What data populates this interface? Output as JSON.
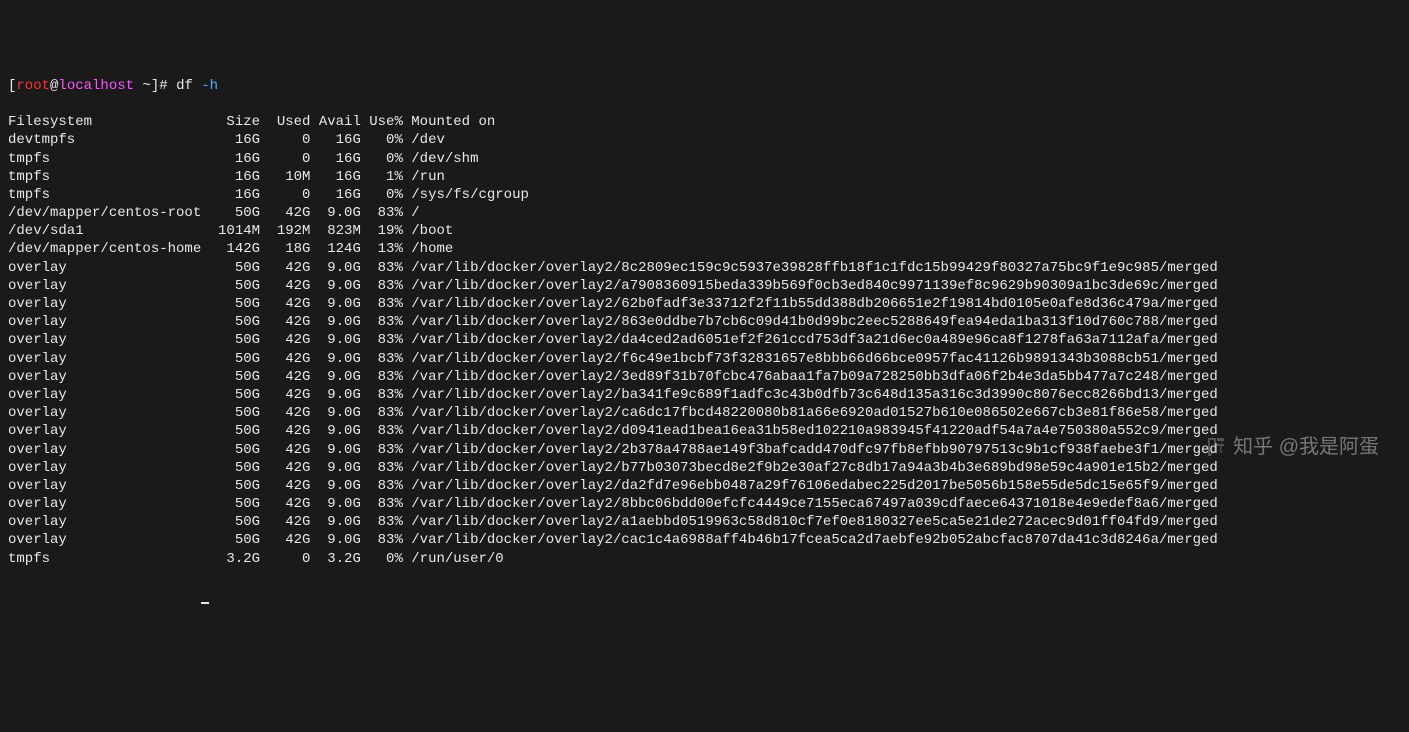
{
  "prompt": {
    "open_bracket": "[",
    "user": "root",
    "at": "@",
    "host": "localhost",
    "space": " ",
    "tilde": "~",
    "close_bracket": "]#",
    "command": " df ",
    "flag": "-h"
  },
  "header": {
    "filesystem": "Filesystem",
    "size": "Size",
    "used": "Used",
    "avail": "Avail",
    "usep": "Use%",
    "mounted": "Mounted on"
  },
  "chart_data": {
    "type": "table",
    "columns": [
      "Filesystem",
      "Size",
      "Used",
      "Avail",
      "Use%",
      "Mounted on"
    ],
    "rows": [
      [
        "devtmpfs",
        "16G",
        "0",
        "16G",
        "0%",
        "/dev"
      ],
      [
        "tmpfs",
        "16G",
        "0",
        "16G",
        "0%",
        "/dev/shm"
      ],
      [
        "tmpfs",
        "16G",
        "10M",
        "16G",
        "1%",
        "/run"
      ],
      [
        "tmpfs",
        "16G",
        "0",
        "16G",
        "0%",
        "/sys/fs/cgroup"
      ],
      [
        "/dev/mapper/centos-root",
        "50G",
        "42G",
        "9.0G",
        "83%",
        "/"
      ],
      [
        "/dev/sda1",
        "1014M",
        "192M",
        "823M",
        "19%",
        "/boot"
      ],
      [
        "/dev/mapper/centos-home",
        "142G",
        "18G",
        "124G",
        "13%",
        "/home"
      ],
      [
        "overlay",
        "50G",
        "42G",
        "9.0G",
        "83%",
        "/var/lib/docker/overlay2/8c2809ec159c9c5937e39828ffb18f1c1fdc15b99429f80327a75bc9f1e9c985/merged"
      ],
      [
        "overlay",
        "50G",
        "42G",
        "9.0G",
        "83%",
        "/var/lib/docker/overlay2/a7908360915beda339b569f0cb3ed840c9971139ef8c9629b90309a1bc3de69c/merged"
      ],
      [
        "overlay",
        "50G",
        "42G",
        "9.0G",
        "83%",
        "/var/lib/docker/overlay2/62b0fadf3e33712f2f11b55dd388db206651e2f19814bd0105e0afe8d36c479a/merged"
      ],
      [
        "overlay",
        "50G",
        "42G",
        "9.0G",
        "83%",
        "/var/lib/docker/overlay2/863e0ddbe7b7cb6c09d41b0d99bc2eec5288649fea94eda1ba313f10d760c788/merged"
      ],
      [
        "overlay",
        "50G",
        "42G",
        "9.0G",
        "83%",
        "/var/lib/docker/overlay2/da4ced2ad6051ef2f261ccd753df3a21d6ec0a489e96ca8f1278fa63a7112afa/merged"
      ],
      [
        "overlay",
        "50G",
        "42G",
        "9.0G",
        "83%",
        "/var/lib/docker/overlay2/f6c49e1bcbf73f32831657e8bbb66d66bce0957fac41126b9891343b3088cb51/merged"
      ],
      [
        "overlay",
        "50G",
        "42G",
        "9.0G",
        "83%",
        "/var/lib/docker/overlay2/3ed89f31b70fcbc476abaa1fa7b09a728250bb3dfa06f2b4e3da5bb477a7c248/merged"
      ],
      [
        "overlay",
        "50G",
        "42G",
        "9.0G",
        "83%",
        "/var/lib/docker/overlay2/ba341fe9c689f1adfc3c43b0dfb73c648d135a316c3d3990c8076ecc8266bd13/merged"
      ],
      [
        "overlay",
        "50G",
        "42G",
        "9.0G",
        "83%",
        "/var/lib/docker/overlay2/ca6dc17fbcd48220080b81a66e6920ad01527b610e086502e667cb3e81f86e58/merged"
      ],
      [
        "overlay",
        "50G",
        "42G",
        "9.0G",
        "83%",
        "/var/lib/docker/overlay2/d0941ead1bea16ea31b58ed102210a983945f41220adf54a7a4e750380a552c9/merged"
      ],
      [
        "overlay",
        "50G",
        "42G",
        "9.0G",
        "83%",
        "/var/lib/docker/overlay2/2b378a4788ae149f3bafcadd470dfc97fb8efbb90797513c9b1cf938faebe3f1/merged"
      ],
      [
        "overlay",
        "50G",
        "42G",
        "9.0G",
        "83%",
        "/var/lib/docker/overlay2/b77b03073becd8e2f9b2e30af27c8db17a94a3b4b3e689bd98e59c4a901e15b2/merged"
      ],
      [
        "overlay",
        "50G",
        "42G",
        "9.0G",
        "83%",
        "/var/lib/docker/overlay2/da2fd7e96ebb0487a29f76106edabec225d2017be5056b158e55de5dc15e65f9/merged"
      ],
      [
        "overlay",
        "50G",
        "42G",
        "9.0G",
        "83%",
        "/var/lib/docker/overlay2/8bbc06bdd00efcfc4449ce7155eca67497a039cdfaece64371018e4e9edef8a6/merged"
      ],
      [
        "overlay",
        "50G",
        "42G",
        "9.0G",
        "83%",
        "/var/lib/docker/overlay2/a1aebbd0519963c58d810cf7ef0e8180327ee5ca5e21de272acec9d01ff04fd9/merged"
      ],
      [
        "overlay",
        "50G",
        "42G",
        "9.0G",
        "83%",
        "/var/lib/docker/overlay2/cac1c4a6988aff4b46b17fcea5ca2d7aebfe92b052abcfac8707da41c3d8246a/merged"
      ],
      [
        "tmpfs",
        "3.2G",
        "0",
        "3.2G",
        "0%",
        "/run/user/0"
      ]
    ]
  },
  "watermark": "知乎 @我是阿蛋"
}
